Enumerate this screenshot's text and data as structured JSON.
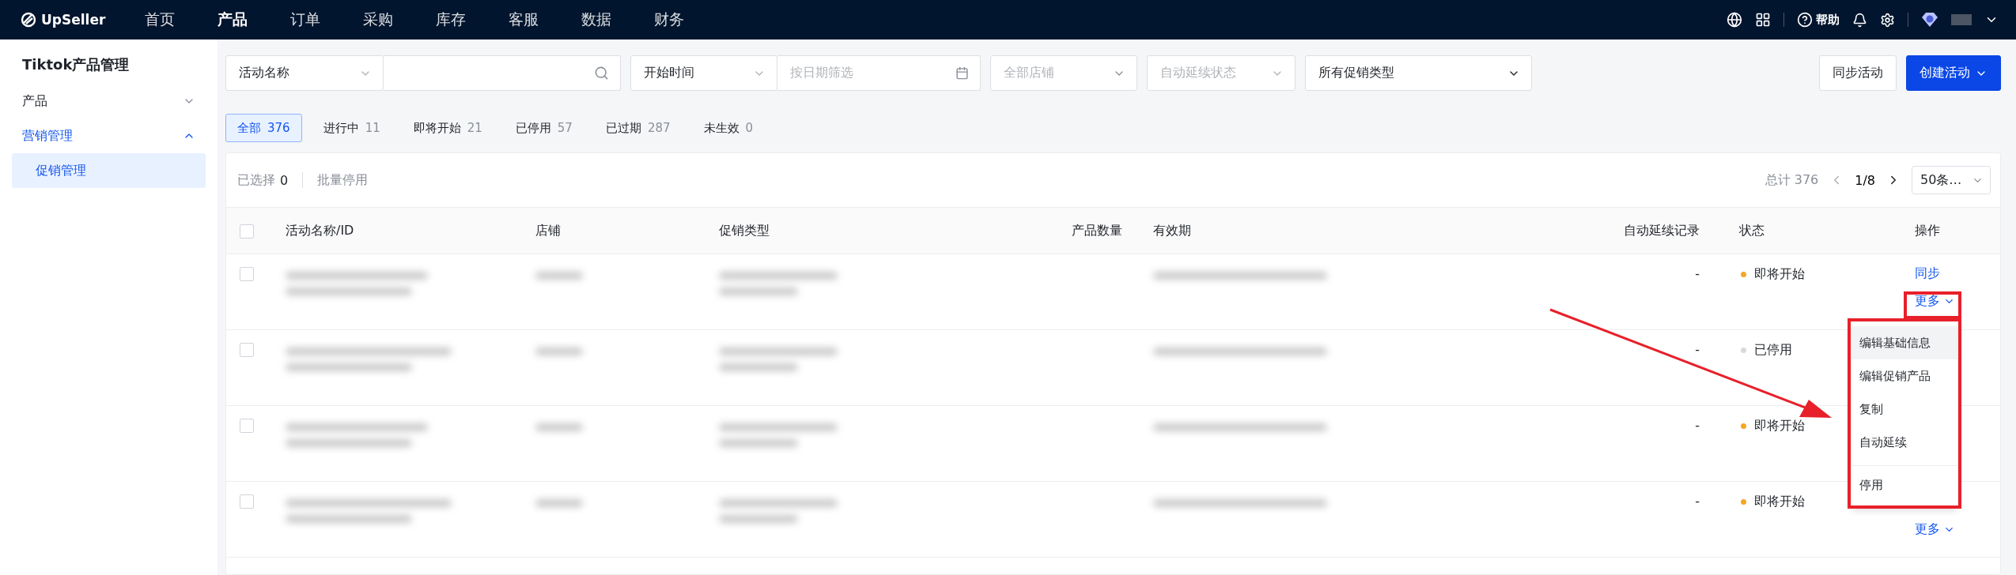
{
  "topbar": {
    "logo": "UpSeller",
    "nav": [
      {
        "label": "首页",
        "selected": false
      },
      {
        "label": "产品",
        "selected": true
      },
      {
        "label": "订单",
        "selected": false
      },
      {
        "label": "采购",
        "selected": false
      },
      {
        "label": "库存",
        "selected": false
      },
      {
        "label": "客服",
        "selected": false
      },
      {
        "label": "数据",
        "selected": false
      },
      {
        "label": "财务",
        "selected": false
      }
    ],
    "help": "帮助"
  },
  "sidebar": {
    "title": "Tiktok产品管理",
    "groups": [
      {
        "label": "产品",
        "expanded": false
      },
      {
        "label": "营销管理",
        "expanded": true,
        "children": [
          {
            "label": "促销管理",
            "selected": true
          }
        ]
      }
    ]
  },
  "filters": {
    "name_select": "活动名称",
    "time_select": "开始时间",
    "date_placeholder": "按日期筛选",
    "store_select": "全部店铺",
    "extension_select": "自动延续状态",
    "type_select": "所有促销类型"
  },
  "actions": {
    "sync": "同步活动",
    "create": "创建活动"
  },
  "tabs": [
    {
      "label": "全部",
      "count": "376",
      "selected": true
    },
    {
      "label": "进行中",
      "count": "11",
      "selected": false
    },
    {
      "label": "即将开始",
      "count": "21",
      "selected": false
    },
    {
      "label": "已停用",
      "count": "57",
      "selected": false
    },
    {
      "label": "已过期",
      "count": "287",
      "selected": false
    },
    {
      "label": "未生效",
      "count": "0",
      "selected": false
    }
  ],
  "toolbar": {
    "selected_label": "已选择",
    "selected_count": "0",
    "bulk_disable": "批量停用",
    "total": "总计 376",
    "page": "1/8",
    "page_size": "50条…"
  },
  "table": {
    "header_checked": false,
    "columns": [
      "活动名称/ID",
      "店铺",
      "促销类型",
      "产品数量",
      "有效期",
      "自动延续记录",
      "状态",
      "操作"
    ],
    "rows": [
      {
        "checked": false,
        "extension": "-",
        "status": "即将开始",
        "color": "#f5a623",
        "actions": [
          {
            "label": "同步",
            "kind": "link"
          },
          {
            "label": "更多",
            "kind": "more"
          }
        ]
      },
      {
        "checked": false,
        "extension": "-",
        "status": "已停用",
        "color": "#d9d9d9",
        "actions": []
      },
      {
        "checked": false,
        "extension": "-",
        "status": "即将开始",
        "color": "#f5a623",
        "actions": []
      },
      {
        "checked": false,
        "extension": "-",
        "status": "即将开始",
        "color": "#f5a623",
        "actions": [
          {
            "label": "更多",
            "kind": "more"
          }
        ]
      }
    ]
  },
  "menu": {
    "items": [
      {
        "label": "编辑基础信息",
        "highlighted": true,
        "divider_before": false
      },
      {
        "label": "编辑促销产品",
        "highlighted": false,
        "divider_before": false
      },
      {
        "label": "复制",
        "highlighted": false,
        "divider_before": false
      },
      {
        "label": "自动延续",
        "highlighted": false,
        "divider_before": false
      },
      {
        "label": "停用",
        "highlighted": false,
        "divider_before": true
      }
    ]
  }
}
